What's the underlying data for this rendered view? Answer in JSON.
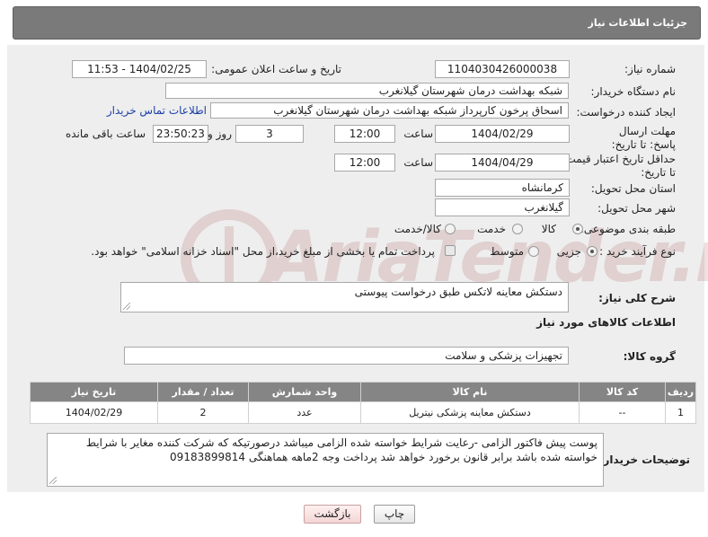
{
  "header": {
    "title": "جزئیات اطلاعات نیاز"
  },
  "fields": {
    "need_number_label": "شماره نیاز:",
    "need_number": "1104030426000038",
    "announce_label": "تاریخ و ساعت اعلان عمومی:",
    "announce_value": "1404/02/25 - 11:53",
    "buyer_org_label": "نام دستگاه خریدار:",
    "buyer_org": "شبکه بهداشت درمان شهرستان گیلانغرب",
    "requester_label": "ایجاد کننده درخواست:",
    "requester": "اسحاق پرخون کارپرداز شبکه بهداشت درمان شهرستان گیلانغرب",
    "buyer_contact_link": "اطلاعات تماس خریدار",
    "reply_deadline_label": "مهلت ارسال پاسخ: تا تاریخ:",
    "reply_date": "1404/02/29",
    "time_label": "ساعت",
    "reply_time": "12:00",
    "days_count": "3",
    "days_label": "روز و",
    "remaining_time": "23:50:23",
    "remaining_label": "ساعت باقی مانده",
    "price_validity_label": "حداقل تاریخ اعتبار قیمت: تا تاریخ:",
    "validity_date": "1404/04/29",
    "validity_time": "12:00",
    "province_label": "استان محل تحویل:",
    "province": "کرمانشاه",
    "city_label": "شهر محل تحویل:",
    "city": "گیلانغرب",
    "category_label": "طبقه بندی موضوعی:",
    "category_options": [
      "کالا",
      "خدمت",
      "کالا/خدمت"
    ],
    "process_label": "نوع فرآیند خرید :",
    "process_options": [
      "جزیی",
      "متوسط"
    ],
    "payment_note": "پرداخت تمام یا بخشی از مبلغ خرید،از محل \"اسناد خزانه اسلامی\" خواهد بود."
  },
  "description": {
    "label": "شرح کلی نیاز:",
    "value": "دستکش معاینه لاتکس طبق درخواست پیوستی"
  },
  "goods": {
    "section_title": "اطلاعات کالاهای مورد نیاز",
    "group_label": "گروه کالا:",
    "group_value": "تجهیزات پزشکی و سلامت",
    "columns": [
      "ردیف",
      "کد کالا",
      "نام کالا",
      "واحد شمارش",
      "تعداد / مقدار",
      "تاریخ نیاز"
    ],
    "rows": [
      [
        "1",
        "--",
        "دستکش معاینه پزشکی نیتریل",
        "عدد",
        "2",
        "1404/02/29"
      ]
    ]
  },
  "buyer_notes": {
    "label": "توضیحات خریدار:",
    "value": "پوست پیش فاکتور الزامی -رعایت شرایط خواسته شده الزامی میباشد درصورتیکه که شرکت کننده مغایر با شرایط خواسته شده باشد برابر قانون برخورد خواهد شد پرداخت وجه 2ماهه هماهنگی 09183899814"
  },
  "buttons": {
    "print": "چاپ",
    "back": "بازگشت"
  },
  "watermark": {
    "text": "AriaTender.neT"
  },
  "colors": {
    "header_bg": "#7a7a7a",
    "table_header_bg": "#858585",
    "link": "#1a3fa8",
    "watermark": "#8a1010"
  }
}
